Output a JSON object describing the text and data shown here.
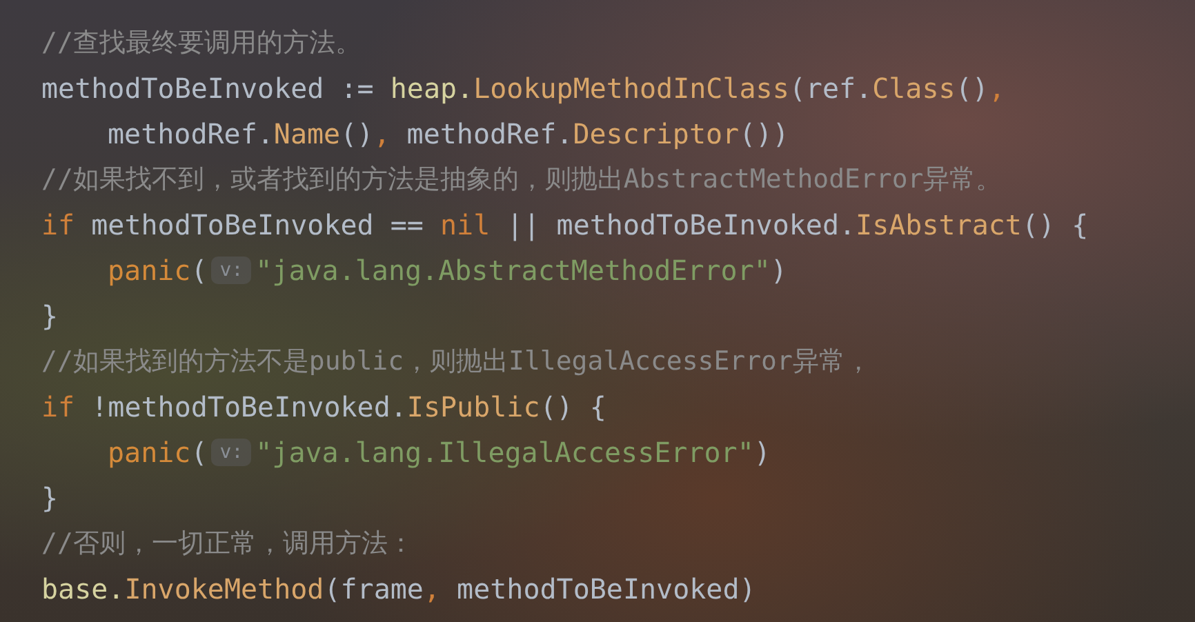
{
  "code_lines": [
    {
      "indented": false,
      "tokens": [
        {
          "kind": "comment",
          "text": "//查找最终要调用的方法。"
        }
      ]
    },
    {
      "indented": false,
      "tokens": [
        {
          "kind": "plain",
          "text": "methodToBeInvoked := "
        },
        {
          "kind": "package",
          "text": "heap."
        },
        {
          "kind": "call",
          "text": "LookupMethodInClass"
        },
        {
          "kind": "plain",
          "text": "(ref."
        },
        {
          "kind": "call",
          "text": "Class"
        },
        {
          "kind": "plain",
          "text": "()"
        },
        {
          "kind": "keyword",
          "text": ","
        }
      ]
    },
    {
      "indented": true,
      "tokens": [
        {
          "kind": "plain",
          "text": "methodRef."
        },
        {
          "kind": "call",
          "text": "Name"
        },
        {
          "kind": "plain",
          "text": "()"
        },
        {
          "kind": "keyword",
          "text": ","
        },
        {
          "kind": "plain",
          "text": " methodRef."
        },
        {
          "kind": "call",
          "text": "Descriptor"
        },
        {
          "kind": "plain",
          "text": "())"
        }
      ]
    },
    {
      "indented": false,
      "tokens": [
        {
          "kind": "comment",
          "text": "//如果找不到，或者找到的方法是抽象的，则抛出AbstractMethodError异常。"
        }
      ]
    },
    {
      "indented": false,
      "tokens": [
        {
          "kind": "keyword",
          "text": "if"
        },
        {
          "kind": "plain",
          "text": " methodToBeInvoked == "
        },
        {
          "kind": "keyword",
          "text": "nil"
        },
        {
          "kind": "plain",
          "text": " || methodToBeInvoked."
        },
        {
          "kind": "call",
          "text": "IsAbstract"
        },
        {
          "kind": "plain",
          "text": "() {"
        }
      ]
    },
    {
      "indented": true,
      "tokens": [
        {
          "kind": "builtin",
          "text": "panic"
        },
        {
          "kind": "plain",
          "text": "("
        },
        {
          "kind": "hint",
          "text": "v:"
        },
        {
          "kind": "string",
          "text": "\"java.lang.AbstractMethodError\""
        },
        {
          "kind": "plain",
          "text": ")"
        }
      ]
    },
    {
      "indented": false,
      "tokens": [
        {
          "kind": "plain",
          "text": "}"
        }
      ]
    },
    {
      "indented": false,
      "tokens": [
        {
          "kind": "comment",
          "text": "//如果找到的方法不是public，则抛出IllegalAccessError异常，"
        }
      ]
    },
    {
      "indented": false,
      "tokens": [
        {
          "kind": "keyword",
          "text": "if"
        },
        {
          "kind": "plain",
          "text": " !methodToBeInvoked."
        },
        {
          "kind": "call",
          "text": "IsPublic"
        },
        {
          "kind": "plain",
          "text": "() {"
        }
      ]
    },
    {
      "indented": true,
      "tokens": [
        {
          "kind": "builtin",
          "text": "panic"
        },
        {
          "kind": "plain",
          "text": "("
        },
        {
          "kind": "hint",
          "text": "v:"
        },
        {
          "kind": "string",
          "text": "\"java.lang.IllegalAccessError\""
        },
        {
          "kind": "plain",
          "text": ")"
        }
      ]
    },
    {
      "indented": false,
      "tokens": [
        {
          "kind": "plain",
          "text": "}"
        }
      ]
    },
    {
      "indented": false,
      "tokens": [
        {
          "kind": "comment",
          "text": "//否则，一切正常，调用方法："
        }
      ]
    },
    {
      "indented": false,
      "tokens": [
        {
          "kind": "package",
          "text": "base."
        },
        {
          "kind": "call",
          "text": "InvokeMethod"
        },
        {
          "kind": "plain",
          "text": "(frame"
        },
        {
          "kind": "keyword",
          "text": ","
        },
        {
          "kind": "plain",
          "text": " methodToBeInvoked)"
        }
      ]
    }
  ]
}
